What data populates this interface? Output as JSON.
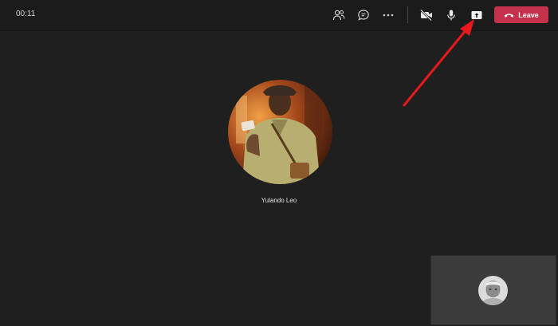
{
  "call": {
    "timer": "00:11",
    "leave_label": "Leave",
    "leave_color": "#c4314b"
  },
  "toolbar": {
    "icons": [
      "people-icon",
      "chat-icon",
      "more-icon",
      "camera-off-icon",
      "microphone-icon",
      "share-screen-icon"
    ]
  },
  "participant": {
    "name": "Yulando Leo"
  },
  "annotation": {
    "arrow_color": "#e8191c"
  }
}
